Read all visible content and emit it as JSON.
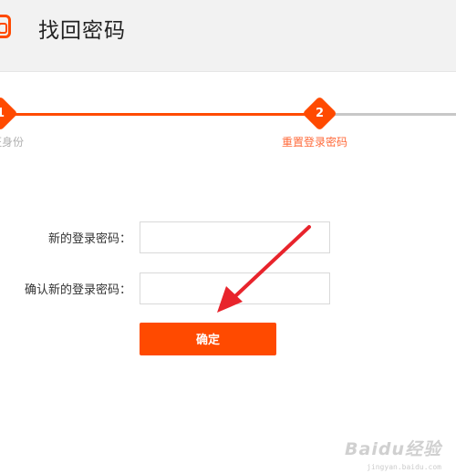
{
  "header": {
    "title": "找回密码"
  },
  "stepper": {
    "steps": [
      {
        "number": "1",
        "label": "证身份",
        "state": "done"
      },
      {
        "number": "2",
        "label": "重置登录密码",
        "state": "active"
      }
    ],
    "accent_color": "#ff4a00",
    "inactive_color": "#c8c8c8"
  },
  "form": {
    "new_password_label": "新的登录密码：",
    "new_password_value": "",
    "confirm_password_label": "确认新的登录密码：",
    "confirm_password_value": "",
    "submit_label": "确定"
  },
  "watermark": {
    "brand": "Baidu经验",
    "url": "jingyan.baidu.com"
  }
}
